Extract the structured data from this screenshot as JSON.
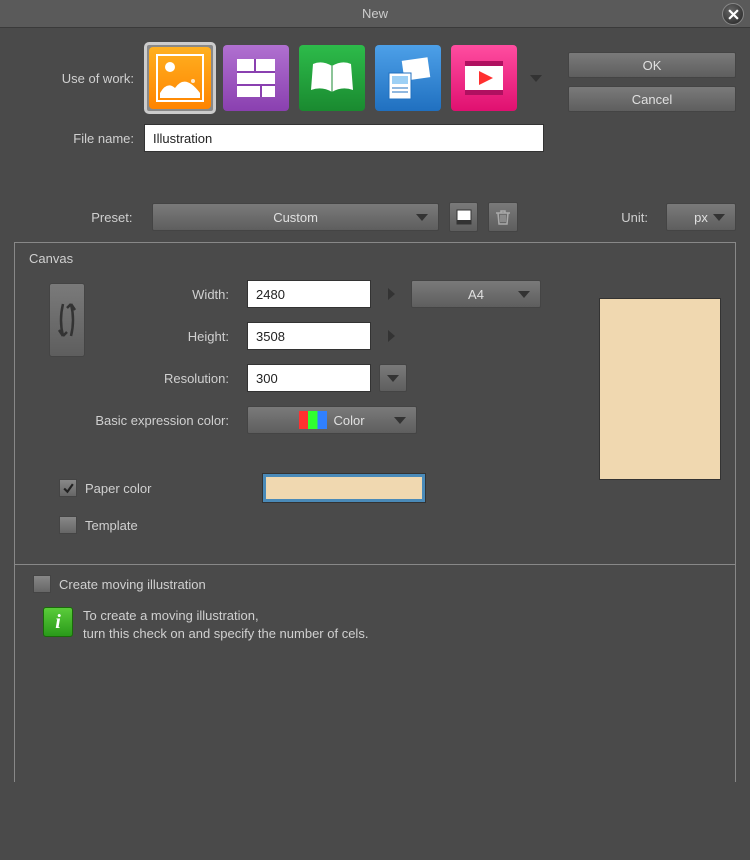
{
  "title": "New",
  "buttons": {
    "ok": "OK",
    "cancel": "Cancel"
  },
  "labels": {
    "use_of_work": "Use of work:",
    "file_name": "File name:",
    "preset": "Preset:",
    "unit": "Unit:",
    "canvas": "Canvas",
    "width": "Width:",
    "height": "Height:",
    "resolution": "Resolution:",
    "basic_color": "Basic expression color:",
    "paper_color": "Paper color",
    "template": "Template",
    "create_moving": "Create moving illustration"
  },
  "values": {
    "file_name": "Illustration",
    "preset": "Custom",
    "unit": "px",
    "width": "2480",
    "height": "3508",
    "resolution": "300",
    "paper_size": "A4",
    "color_mode": "Color",
    "paper_color_hex": "#f0d8b0"
  },
  "info": {
    "line1": "To create a moving illustration,",
    "line2": "turn this check on and specify the number of cels."
  }
}
